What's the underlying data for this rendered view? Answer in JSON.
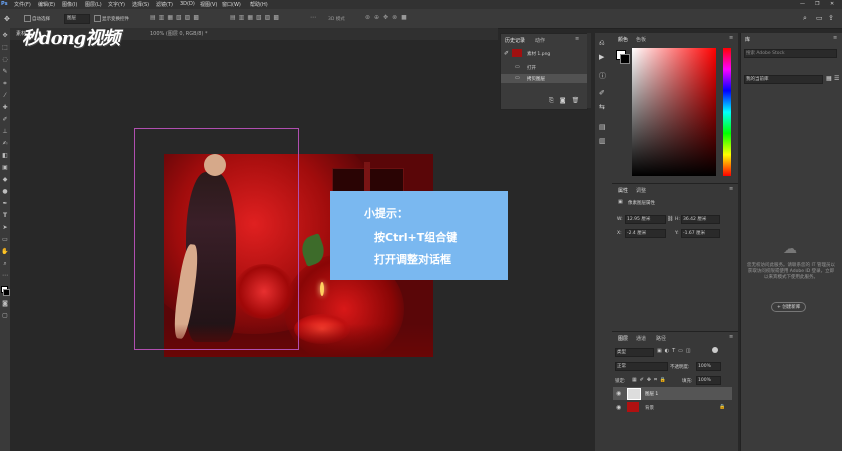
{
  "menubar": {
    "items": [
      "文件(F)",
      "编辑(E)",
      "图像(I)",
      "图层(L)",
      "文字(Y)",
      "选择(S)",
      "滤镜(T)",
      "3D(D)",
      "视图(V)",
      "窗口(W)",
      "帮助(H)"
    ]
  },
  "options": {
    "auto_select": "自动选择",
    "layer_select": "图层",
    "show_transform": "显示变换控件",
    "mode_3d": "3D 模式"
  },
  "doc_tabs": [
    "素材",
    "100% (图层 0, RGB/8) *"
  ],
  "logo": "秒dong视频",
  "tip": {
    "title": "小提示：",
    "line1": "按Ctrl+T组合键",
    "line2": "打开调整对话框"
  },
  "history": {
    "tab_history": "历史记录",
    "tab_actions": "动作",
    "snapshot": "素材 1.png",
    "step1": "打开",
    "step2": "拷贝图层"
  },
  "color_panel": {
    "tab_color": "颜色",
    "tab_swatches": "色板"
  },
  "properties": {
    "tab_properties": "属性",
    "tab_adjust": "调整",
    "title": "像素图层属性",
    "w_label": "W:",
    "w_value": "12.95 厘米",
    "h_label": "H:",
    "h_value": "36.42 厘米",
    "x_label": "X:",
    "x_value": "-2.4 厘米",
    "y_label": "Y:",
    "y_value": "-1.67 厘米"
  },
  "layers": {
    "tab_layers": "图层",
    "tab_channels": "通道",
    "tab_paths": "路径",
    "kind": "类型",
    "blend_mode": "正常",
    "opacity_label": "不透明度:",
    "opacity_value": "100%",
    "lock_label": "锁定:",
    "fill_label": "填充:",
    "fill_value": "100%",
    "layer1": "图层 1",
    "background": "背景"
  },
  "library": {
    "tab": "库",
    "search_placeholder": "搜索 Adobe Stock",
    "selected_lib": "我的当前库",
    "message": "您无权访问此服务。请联系您的 IT 管理员以获取访问权限或使用 Adobe ID 登录，立即以来宾模式下使用此服务。",
    "create_button": "+ 创建新库"
  },
  "colors": {
    "accent_tip": "#7ab8f0",
    "transform_border": "#b04fb0",
    "panel_bg": "#383838"
  }
}
